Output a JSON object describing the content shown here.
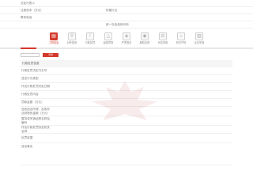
{
  "top_info": {
    "rows": [
      {
        "label": "法定代表人",
        "value": "",
        "label2": "",
        "value2": ""
      },
      {
        "label": "注册资本（万元）",
        "value": "",
        "label2": "所属行业",
        "value2": ""
      },
      {
        "label": "联系电话",
        "value": "",
        "label2": "",
        "value2": ""
      },
      {
        "label": "",
        "value": "",
        "label2": "统一社会信用代码",
        "value2": ""
      }
    ]
  },
  "tabs": [
    {
      "label": "工商信息",
      "icon": "document-icon",
      "active": true
    },
    {
      "label": "对外投资",
      "icon": "network-icon",
      "active": false
    },
    {
      "label": "行政处罚",
      "icon": "alert-icon",
      "active": false
    },
    {
      "label": "经营异常",
      "icon": "warning-icon",
      "active": false
    },
    {
      "label": "严重违法",
      "icon": "shield-icon",
      "active": false
    },
    {
      "label": "股权出质",
      "icon": "stamp-icon",
      "active": false
    },
    {
      "label": "司法协助",
      "icon": "scale-icon",
      "active": false
    },
    {
      "label": "知识产权",
      "icon": "bulb-icon",
      "active": false
    },
    {
      "label": "企业年报",
      "icon": "report-icon",
      "active": false
    }
  ],
  "filter": {
    "input_placeholder": "",
    "button_label": "查询"
  },
  "section": {
    "title": "行政处罚信息",
    "right_text": ""
  },
  "detail_rows": [
    {
      "label": "行政处罚决定书文号",
      "value": "",
      "badge": "",
      "tag": ""
    },
    {
      "label": "违法行为类型",
      "value": "",
      "badge": "",
      "tag": ""
    },
    {
      "label": "作出行政处罚决定日期",
      "value": "",
      "badge": "",
      "tag": ""
    },
    {
      "label": "行政处罚内容",
      "value": "",
      "badge": "",
      "tag": ""
    },
    {
      "label": "罚款金额（万元）",
      "value": "",
      "badge": "",
      "tag": ""
    },
    {
      "label": "没收违法所得、没收非法财物的金额（万元）",
      "value": "",
      "badge": "",
      "tag": ""
    },
    {
      "label": "暂扣或吊销证照名称及编号",
      "value": "",
      "badge": "",
      "tag": ""
    },
    {
      "label": "作出行政处罚决定机关名称",
      "value": "",
      "badge": "",
      "tag": ""
    },
    {
      "label": "处罚依据",
      "value": "",
      "badge": "",
      "tag": ""
    },
    {
      "label": "违法事实",
      "value": "",
      "badge": "",
      "tag": ""
    }
  ],
  "colors": {
    "accent": "#d33a2c",
    "badge_bg": "#fdecea",
    "section_bg": "#f5f5f5"
  }
}
